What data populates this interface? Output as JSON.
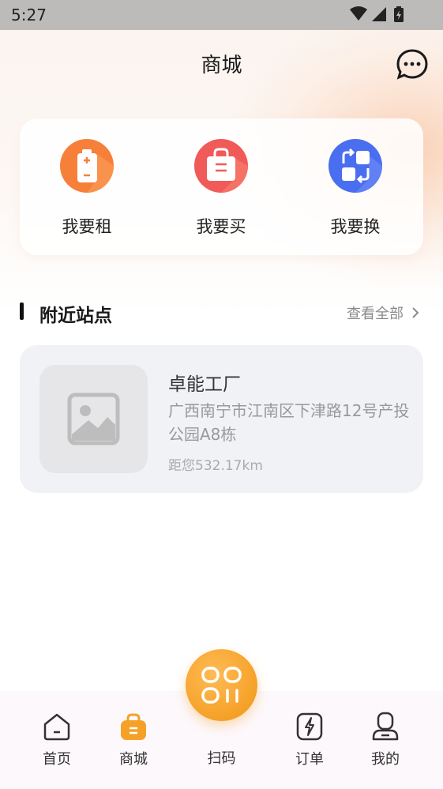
{
  "status_bar": {
    "time": "5:27",
    "icons": [
      "wifi-icon",
      "signal-icon",
      "battery-charging-icon"
    ]
  },
  "header": {
    "title": "商城",
    "message_icon": "chat-bubble-icon"
  },
  "quick_actions": [
    {
      "label": "我要租",
      "icon": "battery-icon",
      "color": "#f6803a"
    },
    {
      "label": "我要买",
      "icon": "shopping-bag-icon",
      "color": "#f05a58"
    },
    {
      "label": "我要换",
      "icon": "swap-icon",
      "color": "#4a6ef0"
    }
  ],
  "nearby": {
    "title": "附近站点",
    "view_all": "查看全部",
    "stations": [
      {
        "name": "卓能工厂",
        "address": "广西南宁市江南区下津路12号产投公园A8栋",
        "distance": "距您532.17km",
        "image_icon": "image-placeholder-icon"
      }
    ]
  },
  "tabbar": {
    "items": [
      {
        "label": "首页",
        "icon": "home-icon",
        "active": false
      },
      {
        "label": "商城",
        "icon": "shop-basket-icon",
        "active": true
      },
      {
        "label": "扫码",
        "icon": "scan-icon",
        "active": false
      },
      {
        "label": "订单",
        "icon": "order-icon",
        "active": false
      },
      {
        "label": "我的",
        "icon": "profile-icon",
        "active": false
      }
    ],
    "accent_color": "#f5a128"
  }
}
